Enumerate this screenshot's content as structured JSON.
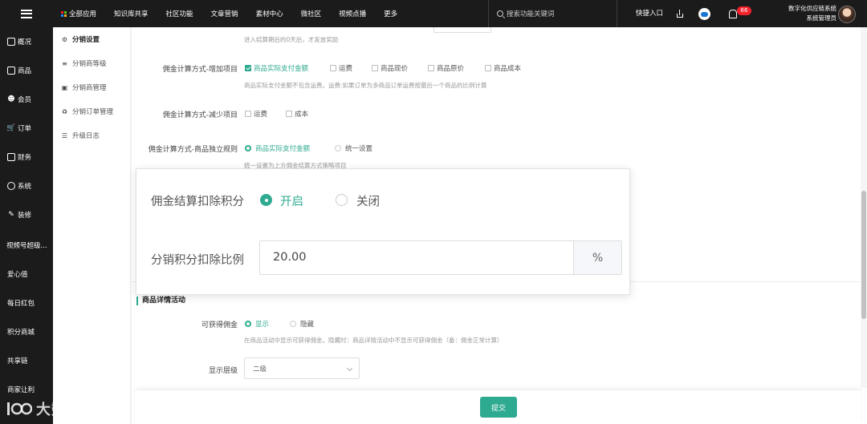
{
  "topbar": {
    "nav": [
      "全部应用",
      "知识库共享",
      "社区功能",
      "文章营销",
      "素材中心",
      "微社区",
      "视频点播",
      "更多"
    ],
    "search_placeholder": "搜索功能关键词",
    "quick_entry": "快捷入口",
    "notification_count": "66",
    "user_org": "数字化供应链系统",
    "user_role": "系统管理员"
  },
  "sidebar": {
    "items": [
      "概况",
      "商品",
      "会员",
      "订单",
      "财务",
      "系统",
      "装修",
      "视频号超级...",
      "爱心值",
      "每日红包",
      "积分商城",
      "共享链",
      "商家让利"
    ]
  },
  "subsidebar": {
    "items": [
      "分销设置",
      "分销商等级",
      "分销商管理",
      "分销订单管理",
      "升级日志"
    ]
  },
  "form": {
    "top_hint": "进入结算期后的0天后，才发放奖励",
    "add_items": {
      "label": "佣金计算方式-增加项目",
      "options": [
        "商品实际支付金额",
        "运费",
        "商品现价",
        "商品原价",
        "商品成本"
      ],
      "hint": "商品实际支付金额不包含运费。运费:如果订单为多商品订单运费按最后一个商品的比例计算"
    },
    "reduce_items": {
      "label": "佣金计算方式-减少项目",
      "options": [
        "运费",
        "成本"
      ]
    },
    "independent_rule": {
      "label": "佣金计算方式-商品独立规则",
      "options": [
        "商品实际支付金额",
        "统一设置"
      ],
      "hint": "统一设置为上方佣金结算方式策略项目"
    },
    "section_title": "商品详情活动",
    "commission_display": {
      "label": "可获得佣金",
      "options": [
        "显示",
        "隐藏"
      ],
      "hint": "在商品活动中显示可获得佣金。隐藏时：商品详情活动中不显示可获得佣金（备：佣金正常计算）"
    },
    "display_level": {
      "label": "显示层级",
      "value": "二级"
    }
  },
  "zoom": {
    "deduct_label": "佣金结算扣除积分",
    "deduct_options": [
      "开启",
      "关闭"
    ],
    "ratio_label": "分销积分扣除比例",
    "ratio_value": "20.00",
    "ratio_suffix": "%"
  },
  "footer": {
    "submit": "提交"
  },
  "watermark": {
    "text": "大数跨境"
  },
  "colors": {
    "accent": "#2eaa91",
    "dark": "#1b1b1b",
    "badge": "#f5222d"
  }
}
